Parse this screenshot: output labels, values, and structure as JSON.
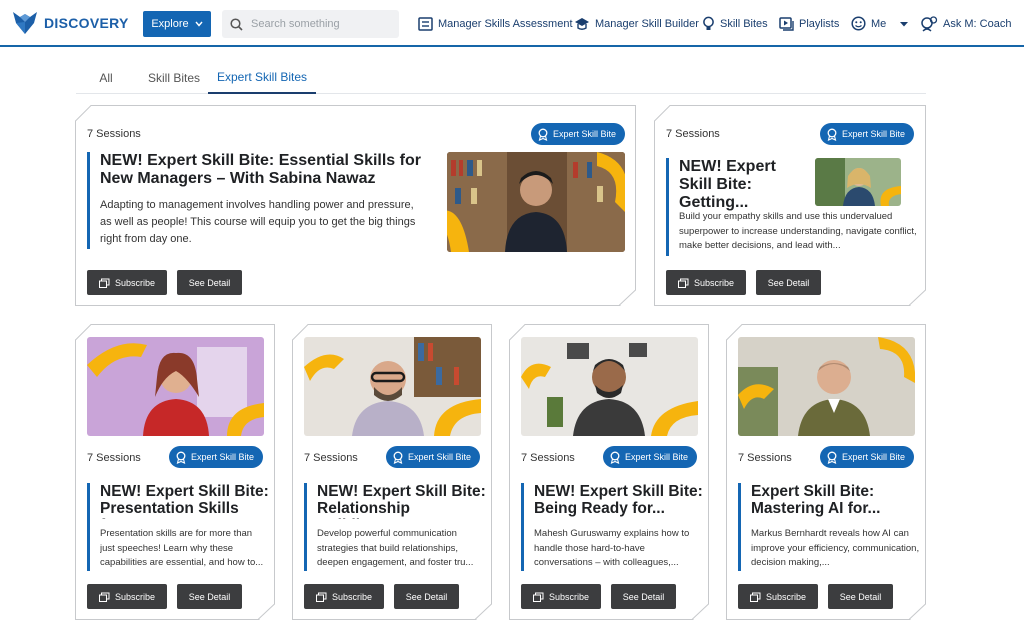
{
  "header": {
    "logo_text": "DISCOVERY",
    "explore_label": "Explore",
    "search_placeholder": "Search something",
    "nav": [
      {
        "label": "Manager Skills Assessment",
        "icon": "assessment-icon"
      },
      {
        "label": "Manager Skill Builder",
        "icon": "graduation-cap-icon"
      },
      {
        "label": "Skill Bites",
        "icon": "lightbulb-icon"
      },
      {
        "label": "Playlists",
        "icon": "playlist-icon"
      },
      {
        "label": "Me",
        "icon": "user-face-icon"
      },
      {
        "label": "Ask M: Coach",
        "icon": "coach-icon"
      }
    ]
  },
  "tabs": [
    {
      "label": "All"
    },
    {
      "label": "Skill Bites"
    },
    {
      "label": "Expert Skill Bites",
      "active": true
    }
  ],
  "colors": {
    "accent": "#1466b3",
    "button": "#3c3d3f",
    "brand": "#1c5fa8",
    "thumb_yellow": "#f6b40e"
  },
  "cards": [
    {
      "sessions": "7 Sessions",
      "badge": "Expert Skill Bite",
      "title": "NEW! Expert Skill Bite: Essential Skills for New Managers – With Sabina Nawaz",
      "description": "Adapting to management involves handling power and pressure, as well as people! This course will equip you to get the big things right from day one.",
      "subscribe": "Subscribe",
      "detail": "See Detail"
    },
    {
      "sessions": "7 Sessions",
      "badge": "Expert Skill Bite",
      "title": "NEW! Expert Skill Bite: Getting...",
      "description": "Build your empathy skills and use this undervalued superpower to increase understanding, navigate conflict, make better decisions, and lead with...",
      "subscribe": "Subscribe",
      "detail": "See Detail"
    },
    {
      "sessions": "7 Sessions",
      "badge": "Expert Skill Bite",
      "title": "NEW! Expert Skill Bite: Presentation Skills fo...",
      "description": "Presentation skills are for more than just speeches! Learn why these capabilities are essential, and how to...",
      "subscribe": "Subscribe",
      "detail": "See Detail"
    },
    {
      "sessions": "7 Sessions",
      "badge": "Expert Skill Bite",
      "title": "NEW! Expert Skill Bite: Relationship Building...",
      "description": "Develop powerful communication strategies that build relationships, deepen engagement, and foster tru...",
      "subscribe": "Subscribe",
      "detail": "See Detail"
    },
    {
      "sessions": "7 Sessions",
      "badge": "Expert Skill Bite",
      "title": "NEW! Expert Skill Bite: Being Ready for...",
      "description": "Mahesh Guruswamy explains how to handle those hard-to-have conversations – with colleagues,...",
      "subscribe": "Subscribe",
      "detail": "See Detail"
    },
    {
      "sessions": "7 Sessions",
      "badge": "Expert Skill Bite",
      "title": "Expert Skill Bite: Mastering AI for...",
      "description": "Markus Bernhardt reveals how AI can improve your efficiency, communication, decision making,...",
      "subscribe": "Subscribe",
      "detail": "See Detail"
    }
  ]
}
